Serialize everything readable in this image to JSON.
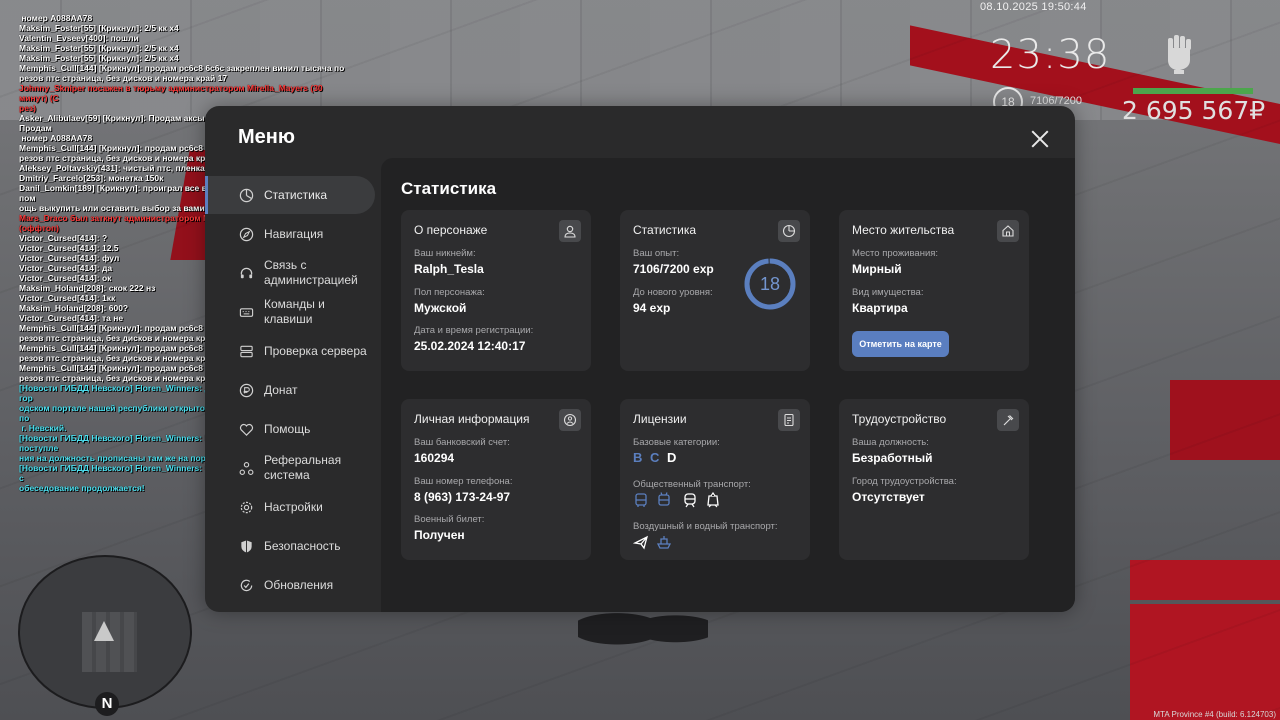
{
  "hud": {
    "datetime": "08.10.2025 19:50:44",
    "clock": "23:38",
    "level": "18",
    "exp": "7106/7200",
    "money": "2 695 567₽",
    "health": 1.0,
    "fist_icon": "fist-icon"
  },
  "chat": [
    {
      "text": " номер А088АА78",
      "color": "white"
    },
    {
      "text": "Maksim_Foster[55] [Крикнул]: 2/5 кк х4",
      "color": "white"
    },
    {
      "text": "Valentin_Evseev[400]: пошли",
      "color": "white"
    },
    {
      "text": "Maksim_Foster[55] [Крикнул]: 2/5 кк х4",
      "color": "white"
    },
    {
      "text": "Maksim_Foster[55] [Крикнул]: 2/5 кк х4",
      "color": "white"
    },
    {
      "text": "Memphis_Cull[144] [Крикнул]: продам рс6с8 6с6с закреплен винил тысяча по",
      "color": "white"
    },
    {
      "text": "резов птс страница, без дисков и номера край 17",
      "color": "white"
    },
    {
      "text": "Johnny_Skniper посажен в тюрьму администратором Mirella_Mayers (30 минут) (С",
      "color": "red"
    },
    {
      "text": "рез)",
      "color": "red"
    },
    {
      "text": "Asker_Alibulaev[59] [Крикнул]: Продам аксы с 6п, сумки кепки, рюкзаки! Продам",
      "color": "white"
    },
    {
      "text": " номер А088АА78",
      "color": "white"
    },
    {
      "text": "Memphis_Cull[144] [Крикнул]: продам рс6с8 6с6с закреплен винил тысяча по",
      "color": "white"
    },
    {
      "text": "резов птс страница, без дисков и номера край 17",
      "color": "white"
    },
    {
      "text": "Aleksey_Poltavskiy[431]: чистый птс, пленка кэнди, базовый стейдж, 4.5кк",
      "color": "white"
    },
    {
      "text": "Dmitriy_Farcelo[253]: монетка 150к",
      "color": "white"
    },
    {
      "text": "Danil_Lomkin[189] [Крикнул]: проиграл все в монетку? не беда выкуп авто в пом",
      "color": "white"
    },
    {
      "text": "ощь выкупить или оставить выбор за вами",
      "color": "white"
    },
    {
      "text": "Mars_Draco был заткнут администратором Matheus_Esposito (30 минут) (оффтоп)",
      "color": "red"
    },
    {
      "text": "Victor_Cursed[414]: ?",
      "color": "white"
    },
    {
      "text": "Victor_Cursed[414]: 12.5",
      "color": "white"
    },
    {
      "text": "Victor_Cursed[414]: фул",
      "color": "white"
    },
    {
      "text": "Victor_Cursed[414]: да",
      "color": "white"
    },
    {
      "text": "Victor_Cursed[414]: ок",
      "color": "white"
    },
    {
      "text": "Maksim_Holand[208]: скок 222 нз",
      "color": "white"
    },
    {
      "text": "Victor_Cursed[414]: 1кк",
      "color": "white"
    },
    {
      "text": "Maksim_Holand[208]: 600?",
      "color": "white"
    },
    {
      "text": "Victor_Cursed[414]: та не",
      "color": "white"
    },
    {
      "text": "Memphis_Cull[144] [Крикнул]: продам рс6с8 6с6с закреплен винил тысяча по",
      "color": "white"
    },
    {
      "text": "резов птс страница, без дисков и номера край 17",
      "color": "white"
    },
    {
      "text": "Memphis_Cull[144] [Крикнул]: продам рс6с8 6с6с закреплен винил тысяча по",
      "color": "white"
    },
    {
      "text": "резов птс страница, без дисков и номера край 17",
      "color": "white"
    },
    {
      "text": "Memphis_Cull[144] [Крикнул]: продам рс6с8 6с6с закреплен винил тысяча по",
      "color": "white"
    },
    {
      "text": "резов птс страница, без дисков и номера край 17",
      "color": "white"
    },
    {
      "text": "[Новости ГИБДД Невского] Floren_Winners: Дорогие жители Провинции! На гор",
      "color": "cyan"
    },
    {
      "text": "одском портале нашей республики открыто заявления на Рядового в ГИБДД по",
      "color": "cyan"
    },
    {
      "text": " г. Невский.",
      "color": "cyan"
    },
    {
      "text": "[Новости ГИБДД Невского] Floren_Winners: Все нужные критерии, для поступле",
      "color": "cyan"
    },
    {
      "text": "ния на должность прописаны там же на портале. Ждём Вас всех!",
      "color": "cyan"
    },
    {
      "text": "[Новости ГИБДД Невского] Floren_Winners: Спасибо за внимание! Ну а наше с",
      "color": "cyan"
    },
    {
      "text": "обеседование продолжается!",
      "color": "cyan"
    }
  ],
  "minimap": {
    "north_label": "N"
  },
  "footer": "MTA Province #4 (build: 6.124703)",
  "menu": {
    "title": "Меню",
    "close_icon": "close-icon",
    "nav": [
      {
        "label": "Статистика",
        "icon": "clock-chart-icon",
        "active": true
      },
      {
        "label": "Навигация",
        "icon": "compass-icon",
        "active": false
      },
      {
        "label": "Связь с администрацией",
        "icon": "headset-icon",
        "active": false
      },
      {
        "label": "Команды и клавиши",
        "icon": "keyboard-icon",
        "active": false
      },
      {
        "label": "Проверка сервера",
        "icon": "server-icon",
        "active": false
      },
      {
        "label": "Донат",
        "icon": "donate-icon",
        "active": false
      },
      {
        "label": "Помощь",
        "icon": "help-heart-icon",
        "active": false
      },
      {
        "label": "Реферальная система",
        "icon": "referral-icon",
        "active": false
      },
      {
        "label": "Настройки",
        "icon": "gear-icon",
        "active": false
      },
      {
        "label": "Безопасность",
        "icon": "shield-icon",
        "active": false
      },
      {
        "label": "Обновления",
        "icon": "update-icon",
        "active": false
      }
    ]
  },
  "content": {
    "title": "Статистика",
    "character": {
      "title": "О персонаже",
      "icon": "user-icon",
      "nick_label": "Ваш никнейм:",
      "nick": "Ralph_Tesla",
      "gender_label": "Пол персонажа:",
      "gender": "Мужской",
      "reg_label": "Дата и время регистрации:",
      "reg": "25.02.2024 12:40:17"
    },
    "stats": {
      "title": "Статистика",
      "icon": "pie-chart-icon",
      "exp_label": "Ваш опыт:",
      "exp": "7106/7200 exp",
      "next_label": "До нового уровня:",
      "next": "94 exp",
      "level": "18",
      "progress": 0.987
    },
    "residence": {
      "title": "Место жительства",
      "icon": "home-icon",
      "place_label": "Место проживания:",
      "place": "Мирный",
      "property_label": "Вид имущества:",
      "property": "Квартира",
      "button": "Отметить на карте"
    },
    "personal": {
      "title": "Личная информация",
      "icon": "info-circle-icon",
      "bank_label": "Ваш банковский счет:",
      "bank": "160294",
      "phone_label": "Ваш номер телефона:",
      "phone": "8 (963) 173-24-97",
      "military_label": "Военный билет:",
      "military": "Получен"
    },
    "licenses": {
      "title": "Лицензии",
      "icon": "license-icon",
      "base_label": "Базовые категории:",
      "categories": [
        {
          "name": "B",
          "color": "#5b7fbf"
        },
        {
          "name": "C",
          "color": "#5b7fbf"
        },
        {
          "name": "D",
          "color": "#ffffff"
        }
      ],
      "public_label": "Общественный транспорт:",
      "public_icons": [
        "bus-icon",
        "trolleybus-icon",
        "train-icon",
        "tram-icon"
      ],
      "air_label": "Воздушный и водный транспорт:",
      "air_icons": [
        "plane-icon",
        "boat-icon"
      ]
    },
    "employment": {
      "title": "Трудоустройство",
      "icon": "hammer-icon",
      "position_label": "Ваша должность:",
      "position": "Безработный",
      "city_label": "Город трудоустройства:",
      "city": "Отсутствует"
    }
  },
  "colors": {
    "accent": "#5b7fbf",
    "panel": "#2a2a2b",
    "content_bg": "#222223",
    "card": "#2d2d2f"
  }
}
